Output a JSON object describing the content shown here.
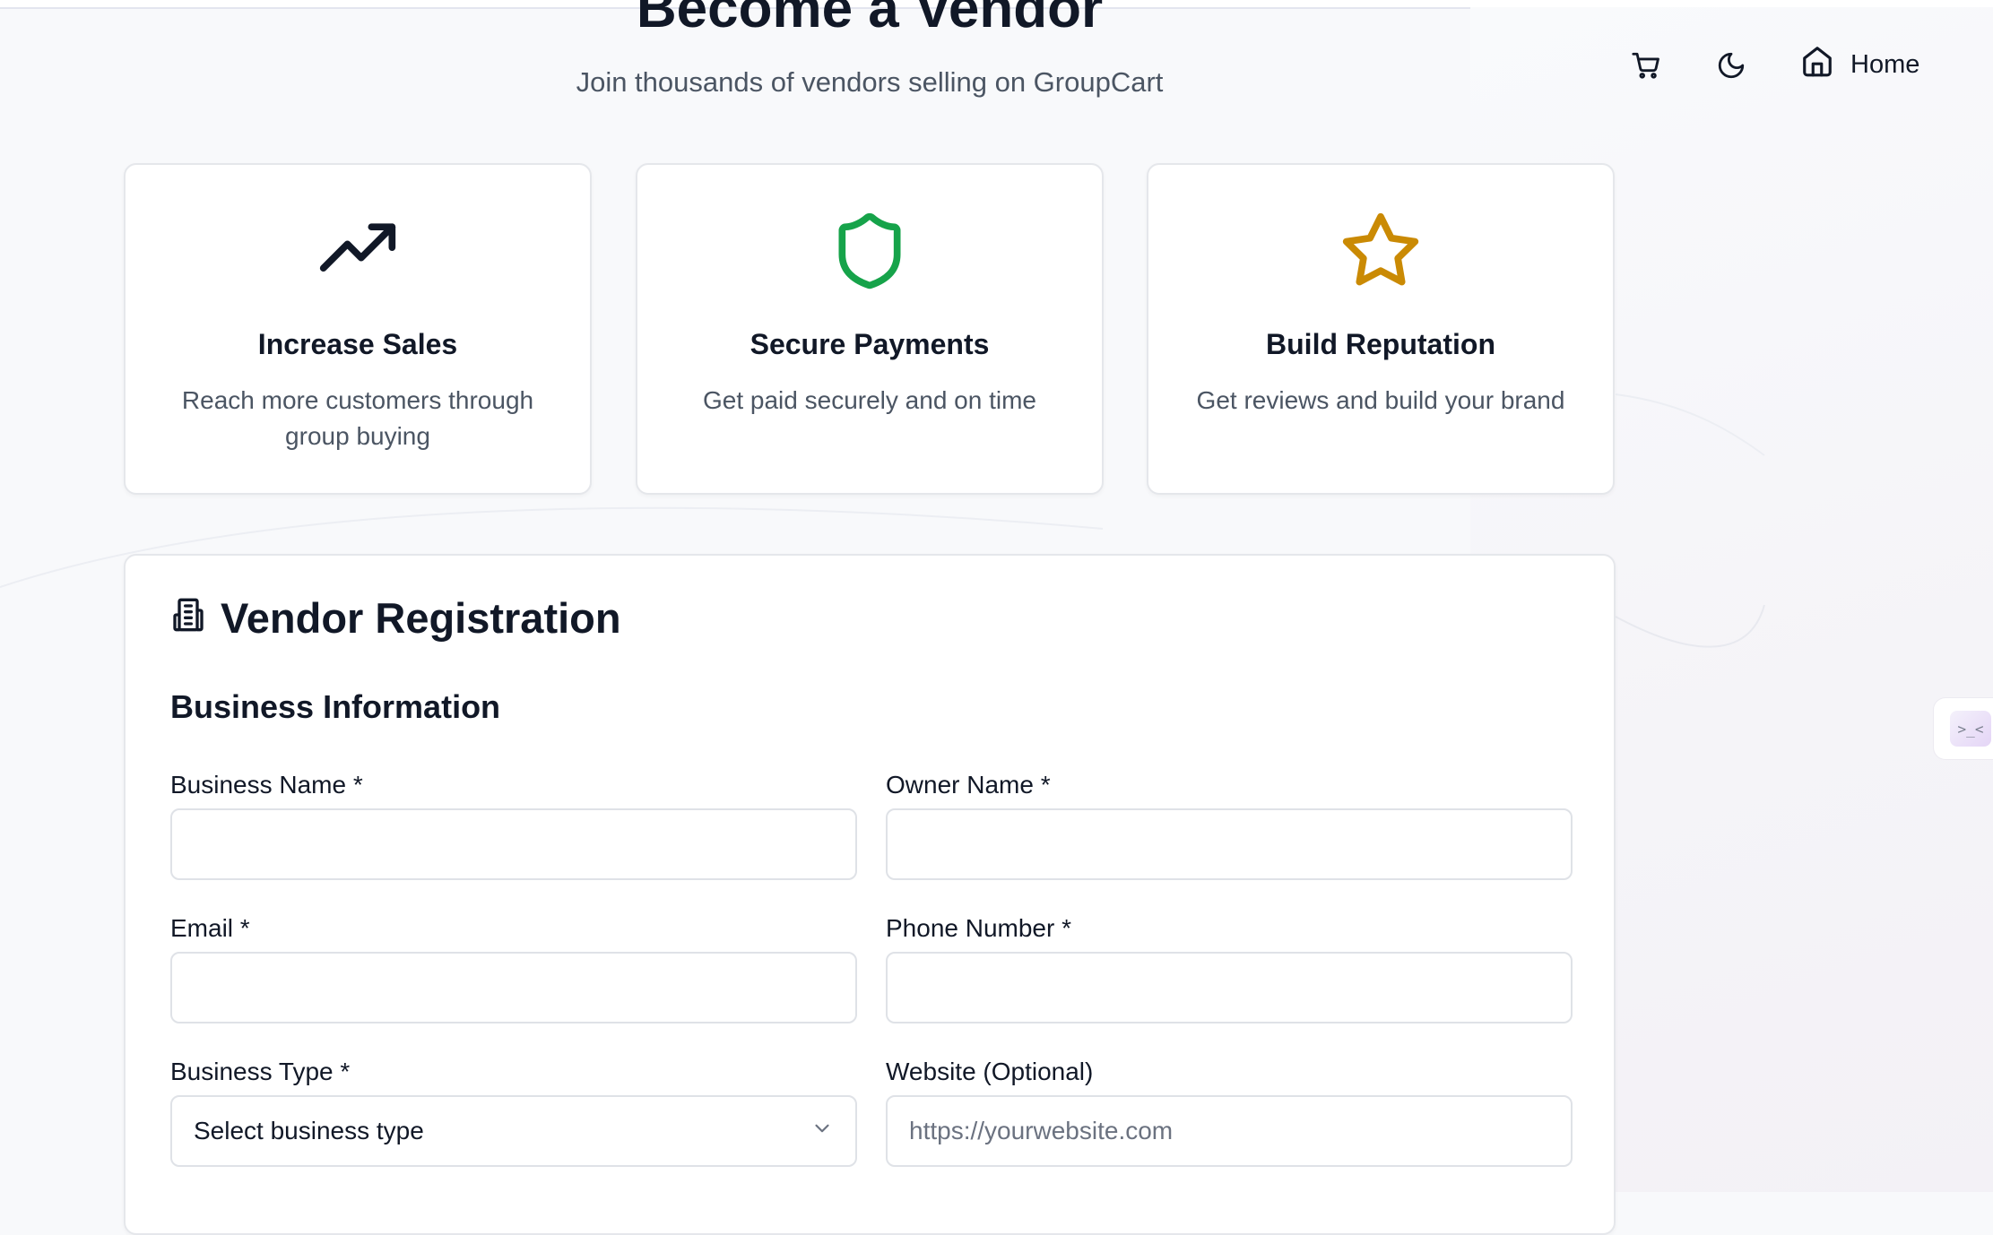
{
  "hero": {
    "title": "Become a Vendor",
    "subtitle": "Join thousands of vendors selling on GroupCart"
  },
  "nav": {
    "home_label": "Home",
    "icons": [
      "cart-icon",
      "moon-icon",
      "home-icon"
    ]
  },
  "features": [
    {
      "icon": "trending-up-icon",
      "title": "Increase Sales",
      "description": "Reach more customers through group buying",
      "icon_color": "#111827"
    },
    {
      "icon": "shield-icon",
      "title": "Secure Payments",
      "description": "Get paid securely and on time",
      "icon_color": "#16a34a"
    },
    {
      "icon": "star-icon",
      "title": "Build Reputation",
      "description": "Get reviews and build your brand",
      "icon_color": "#ca8a04"
    }
  ],
  "form": {
    "title": "Vendor Registration",
    "icon": "building-icon",
    "section": "Business Information",
    "fields": {
      "business_name": {
        "label": "Business Name *",
        "value": "",
        "placeholder": ""
      },
      "owner_name": {
        "label": "Owner Name *",
        "value": "",
        "placeholder": ""
      },
      "email": {
        "label": "Email *",
        "value": "",
        "placeholder": ""
      },
      "phone": {
        "label": "Phone Number *",
        "value": "",
        "placeholder": ""
      },
      "business_type": {
        "label": "Business Type *",
        "selected": "Select business type"
      },
      "website": {
        "label": "Website (Optional)",
        "value": "",
        "placeholder": "https://yourwebsite.com"
      }
    }
  },
  "widget": {
    "glyph": ">_<"
  }
}
